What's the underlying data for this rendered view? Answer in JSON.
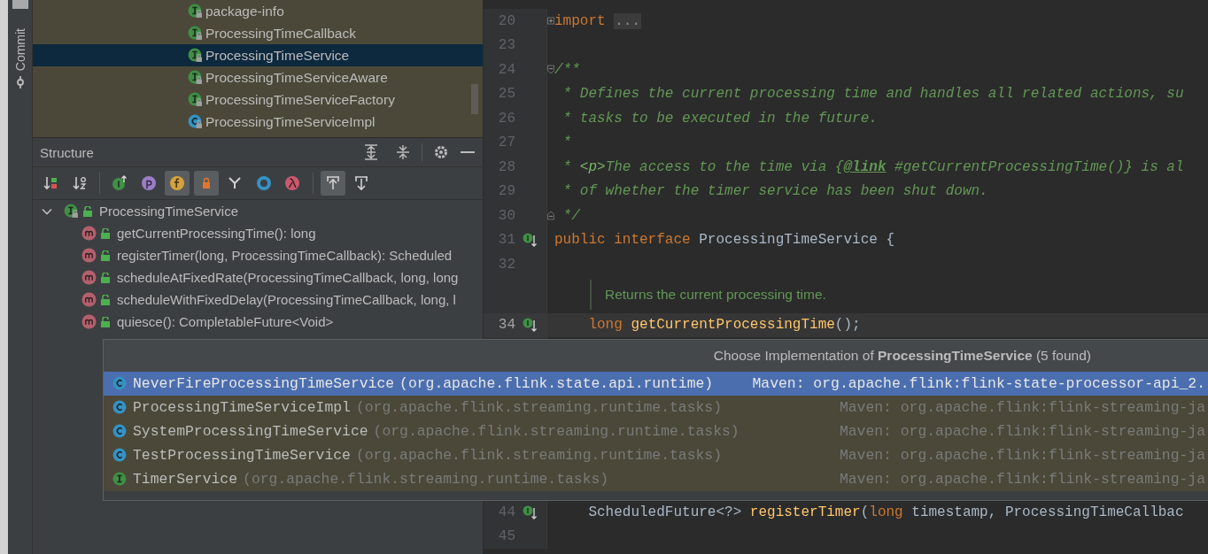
{
  "tool_strip": {
    "label": "Commit"
  },
  "project_tree": {
    "items": [
      {
        "name": "package-info",
        "kind": "interface",
        "selected": false
      },
      {
        "name": "ProcessingTimeCallback",
        "kind": "interface",
        "selected": false
      },
      {
        "name": "ProcessingTimeService",
        "kind": "interface",
        "selected": true
      },
      {
        "name": "ProcessingTimeServiceAware",
        "kind": "interface",
        "selected": false
      },
      {
        "name": "ProcessingTimeServiceFactory",
        "kind": "interface",
        "selected": false
      },
      {
        "name": "ProcessingTimeServiceImpl",
        "kind": "class",
        "selected": false
      }
    ]
  },
  "structure": {
    "title": "Structure",
    "toolbar": [
      {
        "kind": "sort-visibility",
        "selected": false
      },
      {
        "kind": "sort-alpha",
        "selected": false
      },
      {
        "kind": "inherited",
        "selected": false
      },
      {
        "kind": "properties",
        "selected": false
      },
      {
        "kind": "fields",
        "selected": true
      },
      {
        "kind": "non-public",
        "selected": true
      },
      {
        "kind": "fork",
        "selected": false
      },
      {
        "kind": "anonymous",
        "selected": false
      },
      {
        "kind": "lambda",
        "selected": false
      },
      {
        "kind": "scroll-from-source",
        "selected": true
      },
      {
        "kind": "scroll-to-source",
        "selected": false
      }
    ],
    "tree": {
      "name": "ProcessingTimeService",
      "kind": "interface",
      "expanded": true,
      "children": [
        {
          "name": "getCurrentProcessingTime(): long",
          "kind": "method"
        },
        {
          "name": "registerTimer(long, ProcessingTimeCallback): Scheduled",
          "kind": "method"
        },
        {
          "name": "scheduleAtFixedRate(ProcessingTimeCallback, long, long",
          "kind": "method"
        },
        {
          "name": "scheduleWithFixedDelay(ProcessingTimeCallback, long, l",
          "kind": "method"
        },
        {
          "name": "quiesce(): CompletableFuture<Void>",
          "kind": "method"
        }
      ]
    }
  },
  "editor": {
    "lines": [
      {
        "kind": "code",
        "number": "20",
        "fold": {
          "kind": "collapsed"
        },
        "implemented": false,
        "current": false,
        "tokens": [
          {
            "kind": "keyword",
            "text": "import "
          },
          {
            "kind": "folded",
            "text": "..."
          }
        ]
      },
      {
        "kind": "code",
        "number": "23",
        "implemented": false,
        "current": false
      },
      {
        "kind": "code",
        "number": "24",
        "fold": {
          "kind": "start"
        },
        "implemented": false,
        "current": false,
        "tokens": [
          {
            "kind": "comment",
            "text": "/**"
          }
        ]
      },
      {
        "kind": "code",
        "number": "25",
        "implemented": false,
        "current": false,
        "tokens": [
          {
            "kind": "comment",
            "text": " * Defines the current processing time and handles all related actions, su"
          }
        ]
      },
      {
        "kind": "code",
        "number": "26",
        "implemented": false,
        "current": false,
        "tokens": [
          {
            "kind": "comment",
            "text": " * tasks to be executed in the future."
          }
        ]
      },
      {
        "kind": "code",
        "number": "27",
        "implemented": false,
        "current": false,
        "tokens": [
          {
            "kind": "comment",
            "text": " *"
          }
        ]
      },
      {
        "kind": "code",
        "number": "28",
        "implemented": false,
        "current": false,
        "tokens": [
          {
            "kind": "comment",
            "text": " * "
          },
          {
            "kind": "doc-tag",
            "text": "<p>"
          },
          {
            "kind": "comment",
            "text": "The access to the time via {"
          },
          {
            "kind": "link",
            "text": "@link"
          },
          {
            "kind": "comment",
            "text": " #getCurrentProcessingTime()} is al"
          }
        ]
      },
      {
        "kind": "code",
        "number": "29",
        "implemented": false,
        "current": false,
        "tokens": [
          {
            "kind": "comment",
            "text": " * of whether the timer service has been shut down."
          }
        ]
      },
      {
        "kind": "code",
        "number": "30",
        "fold": {
          "kind": "end"
        },
        "implemented": false,
        "current": false,
        "tokens": [
          {
            "kind": "comment",
            "text": " */"
          }
        ]
      },
      {
        "kind": "code",
        "number": "31",
        "implemented": true,
        "current": false,
        "tokens": [
          {
            "kind": "keyword",
            "text": "public interface"
          },
          {
            "kind": "plain",
            "text": " ProcessingTimeService {"
          }
        ]
      },
      {
        "kind": "code",
        "number": "32",
        "implemented": false,
        "current": false
      },
      {
        "kind": "doc",
        "text": "Returns the current processing time."
      },
      {
        "kind": "code",
        "number": "34",
        "implemented": true,
        "current": true,
        "tokens": [
          {
            "kind": "keyword",
            "text": "    long "
          },
          {
            "kind": "method",
            "text": "getCurrentProcessingTime"
          },
          {
            "kind": "plain",
            "text": "();"
          }
        ]
      }
    ],
    "lines_after": [
      {
        "kind": "code",
        "number": "44",
        "implemented": true,
        "current": false,
        "tokens": [
          {
            "kind": "plain",
            "text": "    ScheduledFuture<?> "
          },
          {
            "kind": "method",
            "text": "registerTimer"
          },
          {
            "kind": "plain",
            "text": "("
          },
          {
            "kind": "keyword",
            "text": "long"
          },
          {
            "kind": "plain",
            "text": " timestamp, ProcessingTimeCallbac"
          }
        ]
      },
      {
        "kind": "code",
        "number": "45",
        "implemented": false,
        "current": false
      }
    ]
  },
  "popup": {
    "title": "Choose Implementation of **ProcessingTimeService** (5 found)",
    "items": [
      {
        "kind": "class",
        "name": "NeverFireProcessingTimeService",
        "package": "(org.apache.flink.state.api.runtime)",
        "location": "Maven: org.apache.flink:flink-state-processor-api_2.",
        "selected": true
      },
      {
        "kind": "class",
        "name": "ProcessingTimeServiceImpl",
        "package": "(org.apache.flink.streaming.runtime.tasks)",
        "location": "Maven: org.apache.flink:flink-streaming-ja",
        "selected": false
      },
      {
        "kind": "class",
        "name": "SystemProcessingTimeService",
        "package": "(org.apache.flink.streaming.runtime.tasks)",
        "location": "Maven: org.apache.flink:flink-streaming-ja",
        "selected": false
      },
      {
        "kind": "class",
        "name": "TestProcessingTimeService",
        "package": "(org.apache.flink.streaming.runtime.tasks)",
        "location": "Maven: org.apache.flink:flink-streaming-ja",
        "selected": false
      },
      {
        "kind": "interface",
        "name": "TimerService",
        "package": "(org.apache.flink.streaming.runtime.tasks)",
        "location": "Maven: org.apache.flink:flink-streaming-ja",
        "selected": false
      }
    ]
  }
}
